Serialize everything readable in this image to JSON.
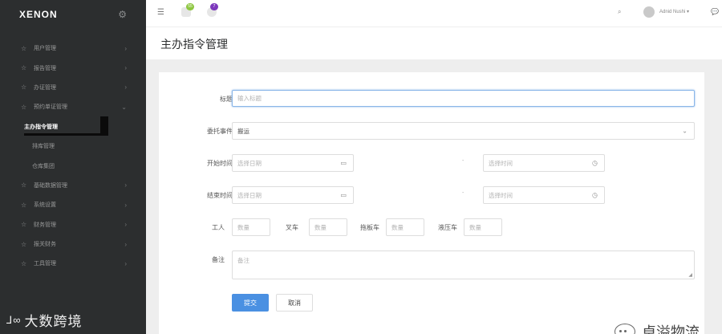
{
  "brand": {
    "logo": "XENON"
  },
  "sidebar": {
    "items": [
      {
        "label": "用户管理"
      },
      {
        "label": "报告管理"
      },
      {
        "label": "办证管理"
      },
      {
        "label": "预约单证管理"
      }
    ],
    "sub_items": [
      {
        "label": "主办指令管理"
      },
      {
        "label": "排库管理"
      },
      {
        "label": "仓库集团"
      }
    ],
    "items_after": [
      {
        "label": "基础数据管理"
      },
      {
        "label": "系统设置"
      },
      {
        "label": "财务管理"
      },
      {
        "label": "报关财务"
      },
      {
        "label": "工具管理"
      }
    ]
  },
  "topbar": {
    "messages_badge": "55",
    "notifications_badge": "7",
    "user_name": "Adnid Nushi ▾"
  },
  "page": {
    "title": "主办指令管理"
  },
  "form": {
    "title_label": "标题",
    "title_placeholder": "输入标题",
    "entrust_label": "委托事件",
    "entrust_value": "搬运",
    "start_label": "开始时间",
    "start_date_placeholder": "选择日期",
    "start_time_placeholder": "选择时间",
    "end_label": "结束时间",
    "end_date_placeholder": "选择日期",
    "end_time_placeholder": "选择时间",
    "range_separator": "-",
    "worker_label": "工人",
    "forklift_label": "叉车",
    "trailer_label": "拖板车",
    "hydraulic_label": "液压车",
    "qty_placeholder": "数量",
    "remark_label": "备注",
    "remark_placeholder": "备注",
    "submit_label": "提交",
    "cancel_label": "取消"
  },
  "watermark": {
    "left_mark": "⅃∞",
    "left_text": "大数跨境",
    "right_text": "卓溢物流"
  },
  "colors": {
    "sidebar_bg": "#2c2e2f",
    "primary": "#4a90e2",
    "messages_badge": "#8dc63f",
    "notifications_badge": "#7c38bc"
  }
}
